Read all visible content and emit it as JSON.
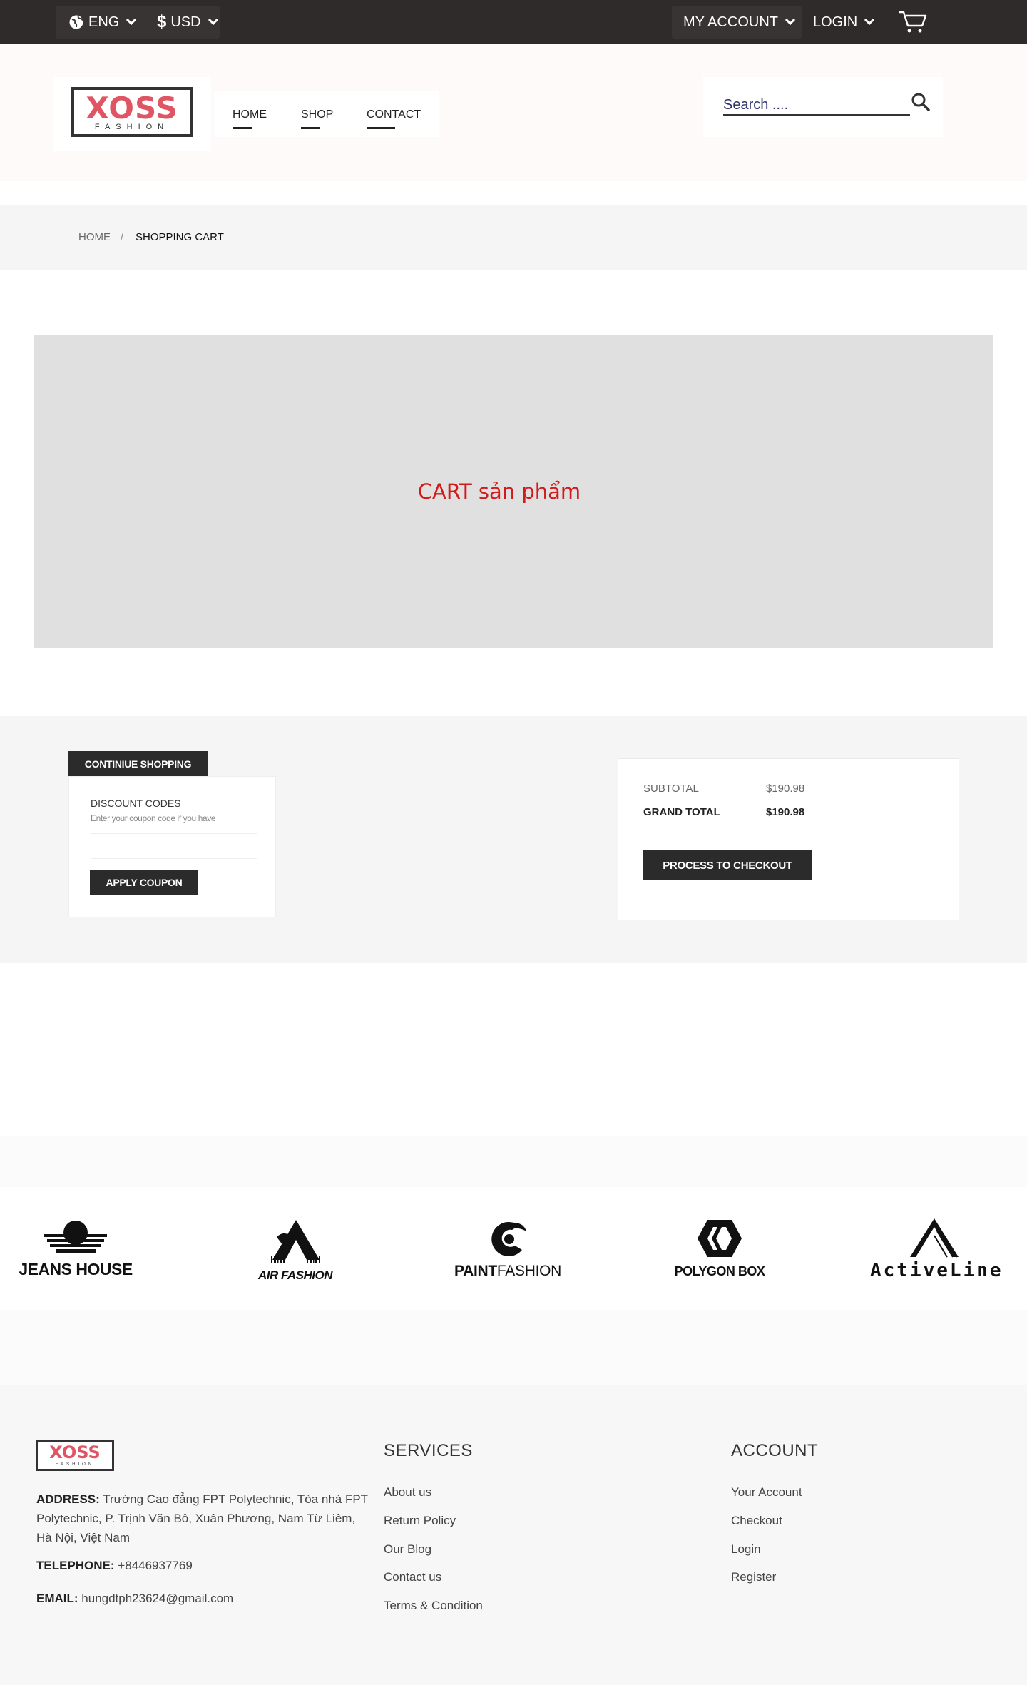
{
  "topbar": {
    "language": "ENG",
    "currency": "USD",
    "my_account": "MY ACCOUNT",
    "login": "LOGIN"
  },
  "header": {
    "logo_text": "XOSS",
    "logo_subtext": "FASHION",
    "nav": [
      "HOME",
      "SHOP",
      "CONTACT"
    ],
    "search_placeholder": "Search ...."
  },
  "breadcrumb": {
    "home": "HOME",
    "separator": "/",
    "current": "SHOPPING CART"
  },
  "cart": {
    "placeholder_label": "CART sản phẩm"
  },
  "totals": {
    "continue_label": "CONTINIUE SHOPPING",
    "discount_title": "DISCOUNT CODES",
    "discount_hint": "Enter your coupon code if you have",
    "coupon_value": "",
    "apply_label": "APPLY COUPON",
    "subtotal_label": "SUBTOTAL",
    "subtotal_value": "$190.98",
    "grand_total_label": "GRAND TOTAL",
    "grand_total_value": "$190.98",
    "checkout_label": "PROCESS TO CHECKOUT"
  },
  "brands": [
    {
      "name": "JEANS HOUSE"
    },
    {
      "name": "AIR FASHION"
    },
    {
      "name_bold": "PAINT",
      "name_light": "FASHION"
    },
    {
      "name": "POLYGON BOX"
    },
    {
      "name": "ActiveLine"
    }
  ],
  "footer": {
    "logo_text": "XOSS",
    "logo_subtext": "FASHION",
    "address_label": "ADDRESS:",
    "address_value": "Trường Cao đẳng FPT Polytechnic, Tòa nhà FPT Polytechnic, P. Trịnh Văn Bô, Xuân Phương, Nam Từ Liêm, Hà Nội, Việt Nam",
    "telephone_label": "TELEPHONE:",
    "telephone_value": "+8446937769",
    "email_label": "EMAIL:",
    "email_value": "hungdtph23624@gmail.com",
    "services_heading": "SERVICES",
    "services": [
      "About us",
      "Return Policy",
      "Our Blog",
      "Contact us",
      "Terms & Condition"
    ],
    "account_heading": "ACCOUNT",
    "account": [
      "Your Account",
      "Checkout",
      "Login",
      "Register"
    ]
  },
  "colors": {
    "topbar_bg": "#2f2b2b",
    "brand_red": "#e05563",
    "cart_label": "#d11a1a",
    "button_dark": "#2b2b2b"
  }
}
